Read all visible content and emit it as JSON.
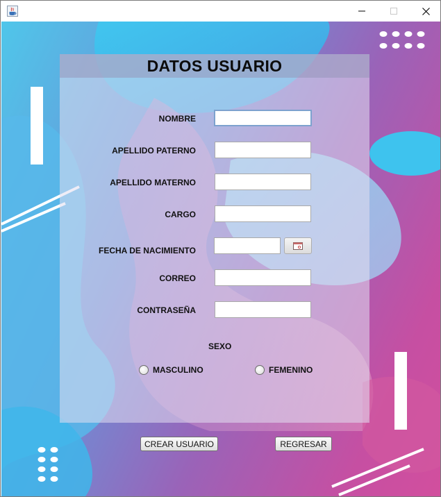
{
  "window": {
    "title": "",
    "controls": {
      "minimize": "minimize-icon",
      "maximize": "maximize-icon",
      "close": "close-icon"
    }
  },
  "form": {
    "title": "DATOS USUARIO",
    "fields": {
      "nombre": {
        "label": "NOMBRE",
        "value": ""
      },
      "apellido_paterno": {
        "label": "APELLIDO PATERNO",
        "value": ""
      },
      "apellido_materno": {
        "label": "APELLIDO MATERNO",
        "value": ""
      },
      "cargo": {
        "label": "CARGO",
        "value": ""
      },
      "fecha_nacimiento": {
        "label": "FECHA DE NACIMIENTO",
        "value": ""
      },
      "correo": {
        "label": "CORREO",
        "value": ""
      },
      "contrasena": {
        "label": "CONTRASEÑA",
        "value": ""
      }
    },
    "sexo": {
      "label": "SEXO",
      "options": [
        "MASCULINO",
        "FEMENINO"
      ],
      "selected": ""
    }
  },
  "buttons": {
    "crear": "CREAR USUARIO",
    "regresar": "REGRESAR"
  },
  "colors": {
    "gradient_left": "#4fc6ea",
    "gradient_right": "#d24f9e",
    "panel": "#e2def0",
    "header": "#9696b9"
  }
}
